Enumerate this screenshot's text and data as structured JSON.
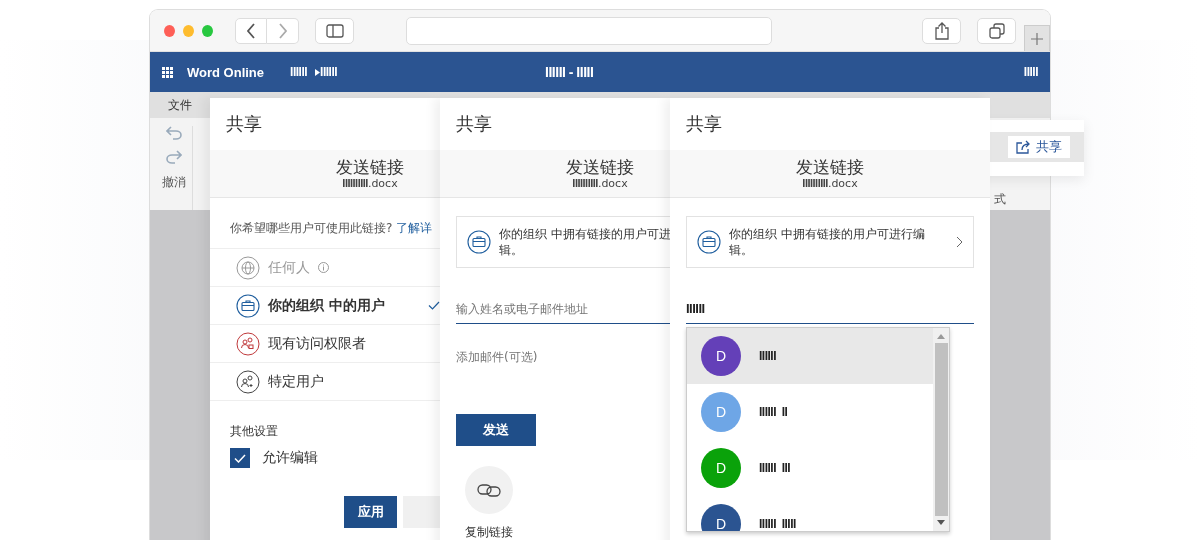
{
  "app_bar": {
    "title": "Word Online",
    "breadcrumb": [
      "IIIIII",
      "IIIIII"
    ],
    "doc_title": "IIIIII - IIIII",
    "user": "IIIII"
  },
  "ribbon": {
    "tabs": [
      {
        "label": "文件",
        "selected": false
      }
    ],
    "undo_label": "撤消",
    "format_label": "式"
  },
  "share_popup": {
    "button": "共享"
  },
  "panels": [
    {
      "kind": "link_settings",
      "title": "共享",
      "header_title": "发送链接",
      "file_name": "IIIIIIIIII",
      "file_ext": ".docx",
      "question": "你希望哪些用户可使用此链接?",
      "learn_more": "了解详",
      "options": [
        {
          "kind": "globe",
          "label": "任何人",
          "disabled": true,
          "selected": false,
          "info": true
        },
        {
          "kind": "organization",
          "label": "你的组织 中的用户",
          "disabled": false,
          "selected": true,
          "info": false
        },
        {
          "kind": "existing",
          "label": "现有访问权限者",
          "disabled": false,
          "selected": false,
          "info": false
        },
        {
          "kind": "specific",
          "label": "特定用户",
          "disabled": false,
          "selected": false,
          "info": false
        }
      ],
      "other_settings_label": "其他设置",
      "allow_edit": {
        "label": "允许编辑",
        "checked": true
      },
      "apply_button": "应用"
    },
    {
      "kind": "send",
      "title": "共享",
      "header_title": "发送链接",
      "file_name": "IIIIIIIIII",
      "file_ext": ".docx",
      "info_lines": [
        "你的组织 中拥有链接的用户可进",
        "辑。"
      ],
      "recipient": {
        "placeholder": "输入姓名或电子邮件地址"
      },
      "message": {
        "placeholder": "添加邮件(可选)"
      },
      "send_button": "发送",
      "copy_link": "复制链接"
    },
    {
      "kind": "suggest",
      "title": "共享",
      "header_title": "发送链接",
      "file_name": "IIIIIIIIII",
      "file_ext": ".docx",
      "info": "你的组织 中拥有链接的用户可进行编辑。",
      "recipient": {
        "value": "IIIIII"
      },
      "suggestions": [
        {
          "initial": "D",
          "name": "IIIIII",
          "color": "#6440b8",
          "selected": true
        },
        {
          "initial": "D",
          "name": "IIIIII  II",
          "color": "#6ea6e6",
          "selected": false
        },
        {
          "initial": "D",
          "name": "IIIIII  III",
          "color": "#0aa20a",
          "selected": false
        },
        {
          "initial": "D",
          "name": "IIIIII  IIIII",
          "color": "#2b5491",
          "selected": false
        }
      ]
    }
  ]
}
